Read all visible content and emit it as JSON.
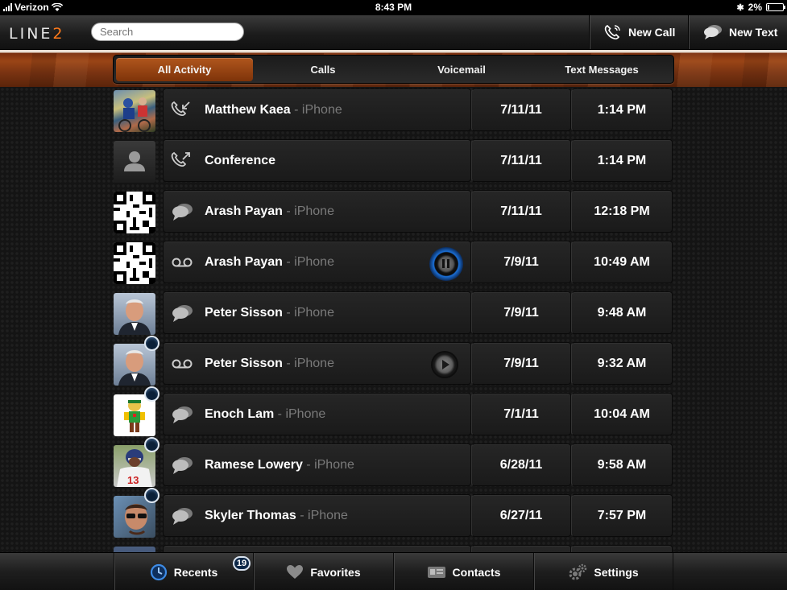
{
  "status_bar": {
    "carrier": "Verizon",
    "time": "8:43 PM",
    "battery": "2%"
  },
  "header": {
    "logo_text": "LINE",
    "logo_suffix": "2",
    "search_placeholder": "Search",
    "new_call_label": "New Call",
    "new_text_label": "New Text"
  },
  "filters": {
    "items": [
      {
        "label": "All Activity",
        "active": true
      },
      {
        "label": "Calls",
        "active": false
      },
      {
        "label": "Voicemail",
        "active": false
      },
      {
        "label": "Text Messages",
        "active": false
      }
    ]
  },
  "activity": [
    {
      "name": "Matthew Kaea",
      "device": " - iPhone",
      "type": "incoming-call",
      "date": "7/11/11",
      "time": "1:14 PM",
      "avatar": "cyclists-photo"
    },
    {
      "name": "Conference",
      "device": "",
      "type": "outgoing-call",
      "date": "7/11/11",
      "time": "1:14 PM",
      "avatar": "default-person"
    },
    {
      "name": "Arash Payan",
      "device": " - iPhone",
      "type": "text",
      "date": "7/11/11",
      "time": "12:18 PM",
      "avatar": "qr-code"
    },
    {
      "name": "Arash Payan",
      "device": " - iPhone",
      "type": "voicemail",
      "date": "7/9/11",
      "time": "10:49 AM",
      "avatar": "qr-code",
      "playback": "pause"
    },
    {
      "name": "Peter Sisson",
      "device": " - iPhone",
      "type": "text",
      "date": "7/9/11",
      "time": "9:48 AM",
      "avatar": "man-portrait"
    },
    {
      "name": "Peter Sisson",
      "device": " - iPhone",
      "type": "voicemail",
      "date": "7/9/11",
      "time": "9:32 AM",
      "avatar": "man-portrait",
      "playback": "play",
      "unread": true
    },
    {
      "name": "Enoch Lam",
      "device": " - iPhone",
      "type": "text",
      "date": "7/1/11",
      "time": "10:04 AM",
      "avatar": "cartoon-character",
      "unread": true
    },
    {
      "name": "Ramese Lowery",
      "device": " - iPhone",
      "type": "text",
      "date": "6/28/11",
      "time": "9:58 AM",
      "avatar": "football-player",
      "unread": true
    },
    {
      "name": "Skyler Thomas",
      "device": " - iPhone",
      "type": "text",
      "date": "6/27/11",
      "time": "7:57 PM",
      "avatar": "man-sunglasses",
      "unread": true
    }
  ],
  "tabs": {
    "recents": "Recents",
    "recents_badge": "19",
    "favorites": "Favorites",
    "contacts": "Contacts",
    "settings": "Settings"
  },
  "colors": {
    "accent_orange": "#a9501b",
    "logo_orange": "#ff7a1a",
    "badge_blue": "#0d2848",
    "voicemail_ring": "#1b6fd6"
  }
}
